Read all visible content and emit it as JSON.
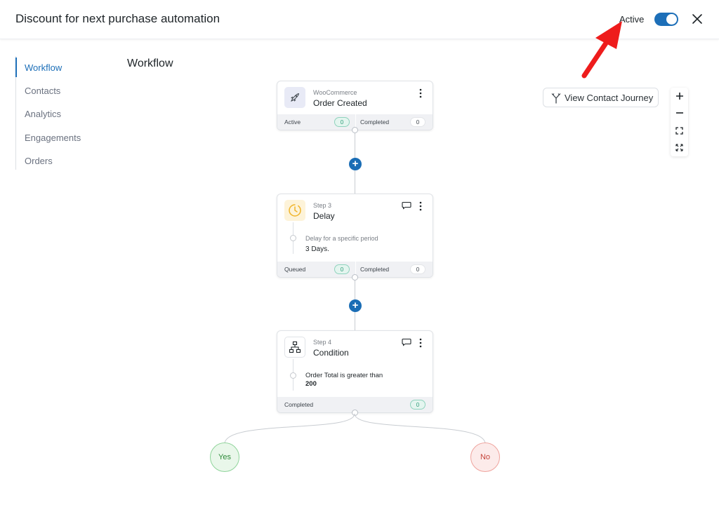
{
  "header": {
    "title": "Discount for next purchase automation",
    "status_label": "Active",
    "toggle_on": true,
    "close_icon": "close-icon"
  },
  "sidebar": {
    "items": [
      {
        "label": "Workflow",
        "active": true
      },
      {
        "label": "Contacts",
        "active": false
      },
      {
        "label": "Analytics",
        "active": false
      },
      {
        "label": "Engagements",
        "active": false
      },
      {
        "label": "Orders",
        "active": false
      }
    ]
  },
  "main": {
    "title": "Workflow",
    "journey_button": "View Contact Journey"
  },
  "zoom": {
    "icons": [
      "zoom-in-icon",
      "zoom-out-icon",
      "fit-screen-icon",
      "fullscreen-icon"
    ]
  },
  "workflow": {
    "trigger": {
      "subtitle": "WooCommerce",
      "title": "Order Created",
      "icon": "rocket-icon",
      "left_label": "Active",
      "left_count": "0",
      "right_label": "Completed",
      "right_count": "0"
    },
    "delay": {
      "subtitle": "Step 3",
      "title": "Delay",
      "icon": "clock-icon",
      "detail_sub": "Delay for a specific period",
      "detail_val": "3 Days.",
      "left_label": "Queued",
      "left_count": "0",
      "right_label": "Completed",
      "right_count": "0"
    },
    "condition": {
      "subtitle": "Step 4",
      "title": "Condition",
      "icon": "sitemap-icon",
      "detail_line1": "Order Total is greater than",
      "detail_line2": "200",
      "footer_label": "Completed",
      "footer_count": "0"
    },
    "branches": {
      "yes": "Yes",
      "no": "No"
    }
  },
  "colors": {
    "accent": "#1d6fb8",
    "annotation_arrow": "#ee1c1c"
  }
}
